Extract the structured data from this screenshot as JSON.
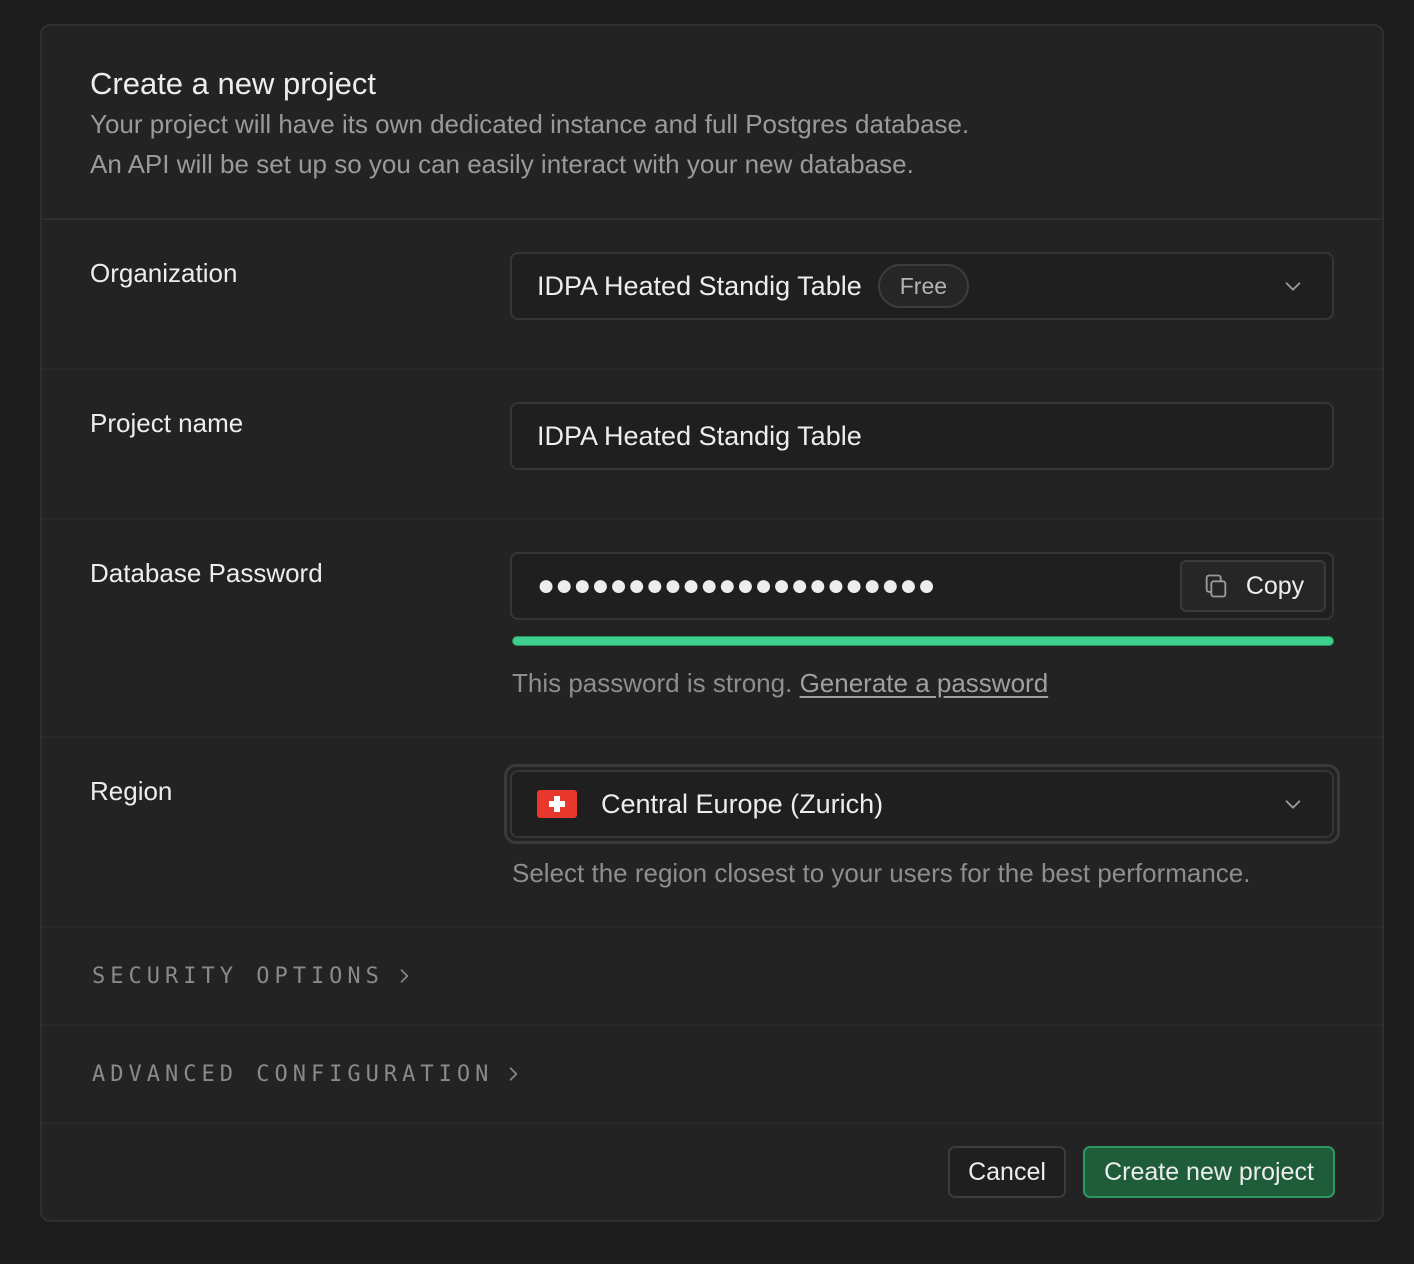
{
  "header": {
    "title": "Create a new project",
    "description_line1": "Your project will have its own dedicated instance and full Postgres database.",
    "description_line2": "An API will be set up so you can easily interact with your new database."
  },
  "organization": {
    "label": "Organization",
    "selected": "IDPA Heated Standig Table",
    "plan_badge": "Free"
  },
  "project_name": {
    "label": "Project name",
    "value": "IDPA Heated Standig Table"
  },
  "password": {
    "label": "Database Password",
    "masked_value": "●●●●●●●●●●●●●●●●●●●●●●",
    "copy_label": "Copy",
    "strength": 1.0,
    "strength_color": "#3ecf8e",
    "helper_text": "This password is strong. ",
    "generate_link": "Generate a password"
  },
  "region": {
    "label": "Region",
    "selected": "Central Europe (Zurich)",
    "flag_icon": "switzerland-flag-icon",
    "helper_text": "Select the region closest to your users for the best performance."
  },
  "sections": {
    "security": "SECURITY OPTIONS",
    "advanced": "ADVANCED CONFIGURATION"
  },
  "footer": {
    "cancel_label": "Cancel",
    "create_label": "Create new project"
  },
  "colors": {
    "background": "#1c1c1c",
    "panel": "#232323",
    "accent_green": "#3ecf8e",
    "create_button": "#1f5c3a"
  }
}
